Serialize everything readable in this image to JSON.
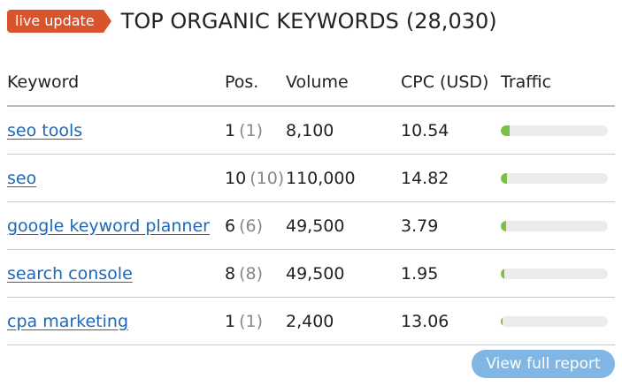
{
  "header": {
    "badge": "live update",
    "title": "TOP ORGANIC KEYWORDS",
    "count": "(28,030)"
  },
  "table": {
    "columns": {
      "keyword": "Keyword",
      "pos": "Pos.",
      "volume": "Volume",
      "cpc": "CPC (USD)",
      "traffic": "Traffic"
    },
    "rows": [
      {
        "keyword": "seo tools",
        "pos": "1",
        "prev_pos": "(1)",
        "volume": "8,100",
        "cpc": "10.54",
        "traffic_fraction": 0.08
      },
      {
        "keyword": "seo",
        "pos": "10",
        "prev_pos": "(10)",
        "volume": "110,000",
        "cpc": "14.82",
        "traffic_fraction": 0.06
      },
      {
        "keyword": "google keyword planner",
        "pos": "6",
        "prev_pos": "(6)",
        "volume": "49,500",
        "cpc": "3.79",
        "traffic_fraction": 0.05
      },
      {
        "keyword": "search console",
        "pos": "8",
        "prev_pos": "(8)",
        "volume": "49,500",
        "cpc": "1.95",
        "traffic_fraction": 0.035
      },
      {
        "keyword": "cpa marketing",
        "pos": "1",
        "prev_pos": "(1)",
        "volume": "2,400",
        "cpc": "13.06",
        "traffic_fraction": 0.02
      }
    ]
  },
  "footer": {
    "view_full_report": "View full report"
  },
  "colors": {
    "badge": "#d9532c",
    "link": "#1f67b5",
    "traffic_fill": "#7cc049",
    "button": "#7fb6e3"
  }
}
